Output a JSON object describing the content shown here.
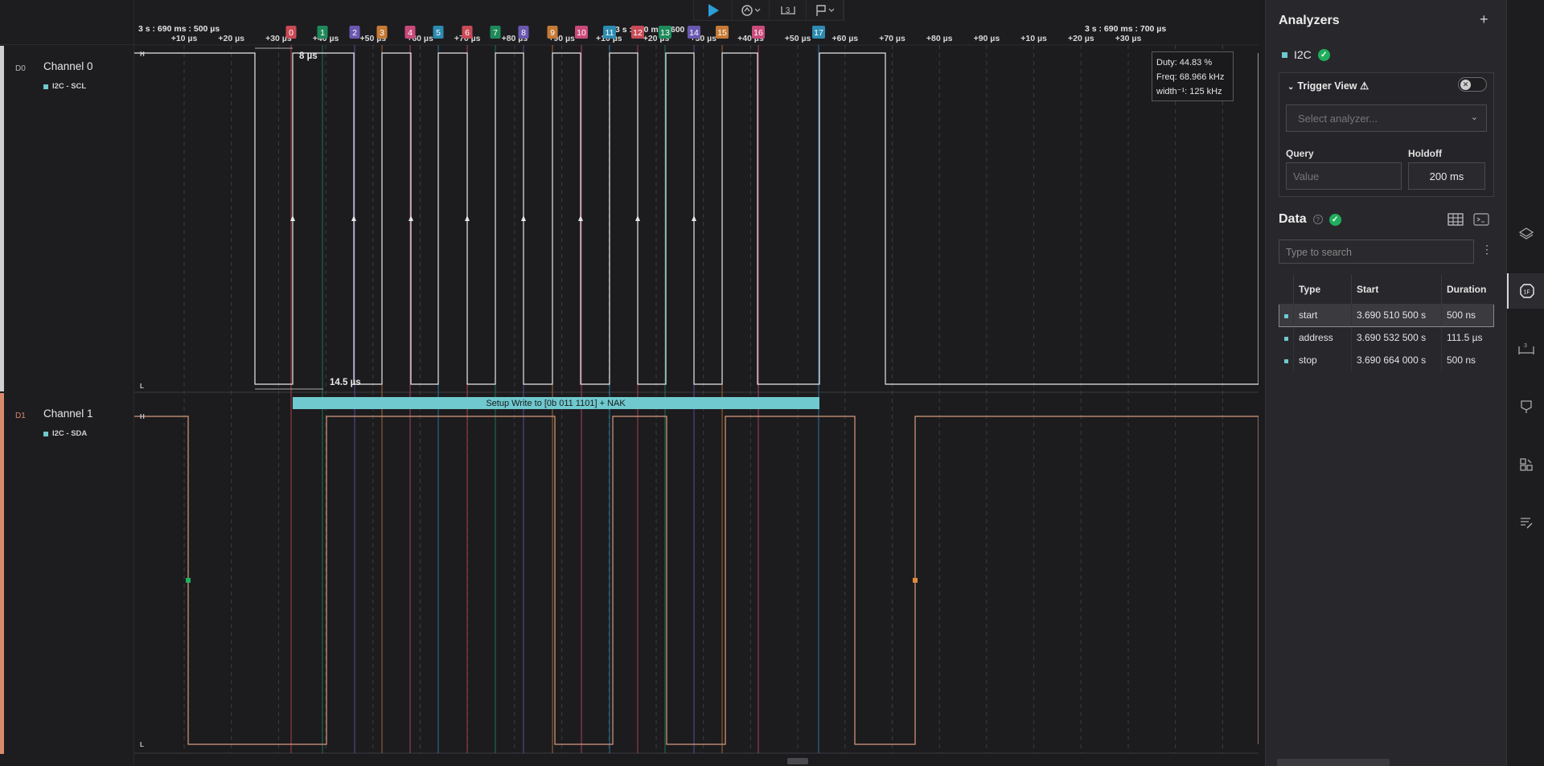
{
  "toolbar": {
    "zoom_count": "3"
  },
  "channels": [
    {
      "dlabel": "D0",
      "name": "Channel 0",
      "analyzer": "I2C - SCL"
    },
    {
      "dlabel": "D1",
      "name": "Channel 1",
      "analyzer": "I2C - SDA"
    }
  ],
  "timeline": {
    "left_anchor": "3 s : 690 ms : 500 µs",
    "mid_anchor": "3 s : 690 ms : 600 µs",
    "right_anchor": "3 s : 690 ms : 700 µs",
    "ticks": [
      "+10 µs",
      "+20 µs",
      "+30 µs",
      "+40 µs",
      "+50 µs",
      "+60 µs",
      "+70 µs",
      "+80 µs",
      "+90 µs",
      "+10 µs",
      "+20 µs",
      "+30 µs",
      "+40 µs",
      "+50 µs",
      "+60 µs",
      "+70 µs",
      "+80 µs",
      "+90 µs",
      "+10 µs",
      "+20 µs",
      "+30 µs"
    ],
    "markers": [
      "0",
      "1",
      "2",
      "3",
      "4",
      "5",
      "6",
      "7",
      "8",
      "9",
      "10",
      "11",
      "12",
      "13",
      "14",
      "15",
      "16",
      "17"
    ],
    "marker_colors": [
      "#c94a55",
      "#1e8a5a",
      "#6a58b0",
      "#c67a35",
      "#c94a7a",
      "#2c8bb0",
      "#c94a55",
      "#1e8a5a",
      "#6a58b0",
      "#c67a35",
      "#c94a7a",
      "#2c8bb0",
      "#c94a55",
      "#1e8a5a",
      "#6a58b0",
      "#c67a35",
      "#c94a7a",
      "#2c8bb0"
    ],
    "measure_width": "8 µs",
    "measure_period": "14.5 µs",
    "level_high": "H",
    "level_low": "L"
  },
  "frame_label": "Setup Write to [0b 011 1101] + NAK",
  "tooltip": {
    "duty": "Duty: 44.83 %",
    "freq": "Freq: 68.966 kHz",
    "width": "width⁻¹: 125 kHz"
  },
  "panel": {
    "analyzers_title": "Analyzers",
    "analyzer_name": "I2C",
    "trigger_title": "Trigger View ⚠",
    "select_placeholder": "Select analyzer...",
    "query_label": "Query",
    "query_placeholder": "Value",
    "holdoff_label": "Holdoff",
    "holdoff_value": "200 ms",
    "data_title": "Data",
    "search_placeholder": "Type to search",
    "columns": [
      "Type",
      "Start",
      "Duration"
    ],
    "rows": [
      {
        "type": "start",
        "start": "3.690 510 500 s",
        "duration": "500 ns"
      },
      {
        "type": "address",
        "start": "3.690 532 500 s",
        "duration": "111.5 µs"
      },
      {
        "type": "stop",
        "start": "3.690 664 000 s",
        "duration": "500 ns"
      }
    ]
  },
  "colors": {
    "scl_wave": "#e8e8e8",
    "sda_wave": "#d99a7a",
    "frame_fill": "#6fc9cf",
    "ch1_stripe": "#d98a6a",
    "ch0_stripe": "#cfcfcf"
  }
}
